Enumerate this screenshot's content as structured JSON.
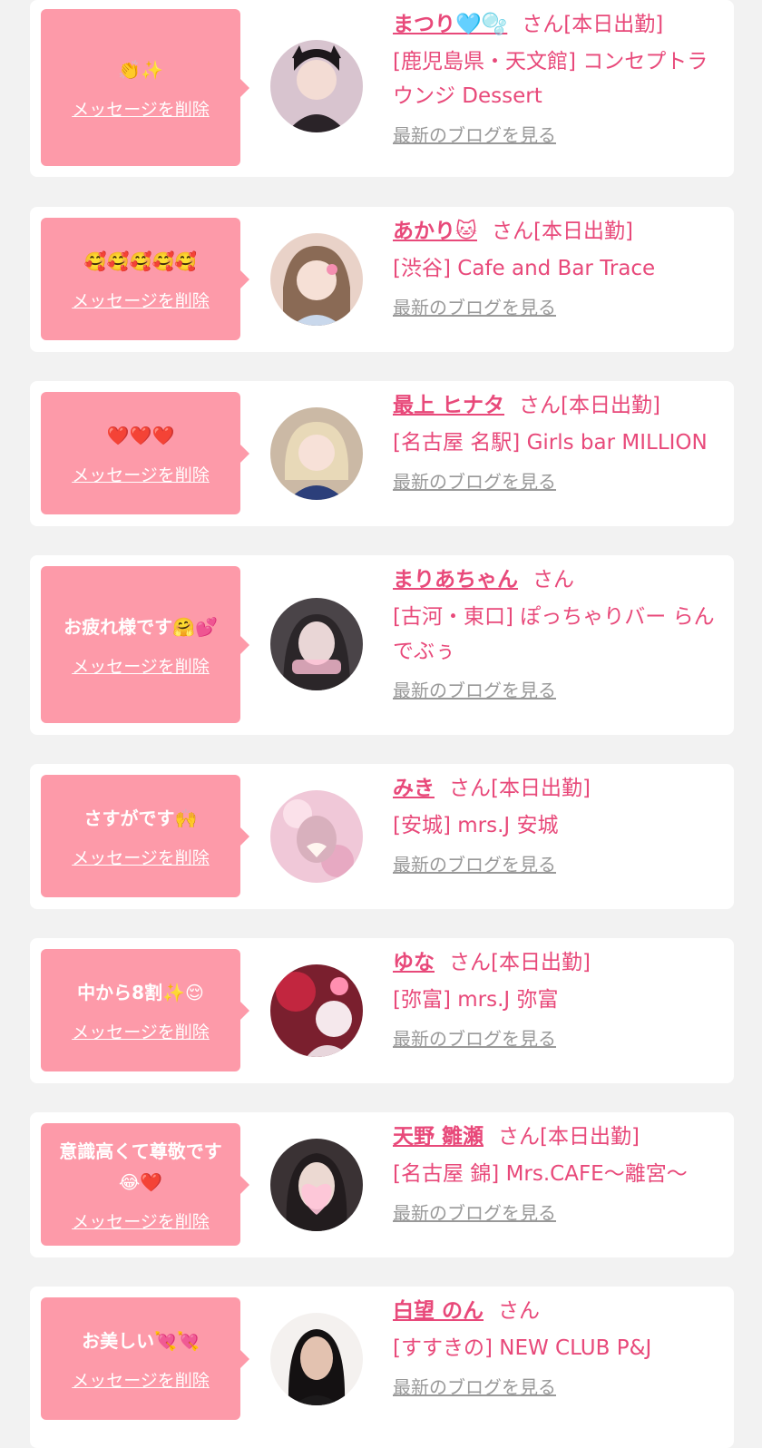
{
  "common": {
    "delete_label": "メッセージを削除",
    "blog_label": "最新のブログを見る"
  },
  "cards": [
    {
      "message": "👏✨",
      "name": "まつり🩵🫧",
      "suffix": "さん[本日出勤]",
      "shop": "[鹿児島県・天文館] コンセプトラウンジ Dessert"
    },
    {
      "message": "🥰🥰🥰🥰🥰",
      "name": "あかり🐱",
      "suffix": "さん[本日出勤]",
      "shop": "[渋谷] Cafe and Bar Trace"
    },
    {
      "message": "❤️❤️❤️",
      "name": "最上 ヒナタ",
      "suffix": "さん[本日出勤]",
      "shop": "[名古屋 名駅] Girls bar MILLION"
    },
    {
      "message": "お疲れ様です🤗💕",
      "name": "まりあちゃん",
      "suffix": "さん",
      "shop": "[古河・東口] ぽっちゃりバー らんでぶぅ"
    },
    {
      "message": "さすがです🙌",
      "name": "みき",
      "suffix": "さん[本日出勤]",
      "shop": "[安城] mrs.J 安城"
    },
    {
      "message": "中から8割✨😌",
      "name": "ゆな",
      "suffix": "さん[本日出勤]",
      "shop": "[弥富] mrs.J 弥富"
    },
    {
      "message": "意識高くて尊敬です😂❤️",
      "name": "天野 雛瀬",
      "suffix": "さん[本日出勤]",
      "shop": "[名古屋 錦] Mrs.CAFE～離宮～"
    },
    {
      "message": "お美しい💘💘",
      "name": "白望 のん",
      "suffix": "さん",
      "shop": "[すすきの] NEW CLUB P&J"
    }
  ],
  "colors": {
    "background": "#f2f2f2",
    "bubble": "#fd9aa9",
    "accent": "#e8497a",
    "link_gray": "#999999"
  },
  "icons": [
    "avatar-photo"
  ]
}
